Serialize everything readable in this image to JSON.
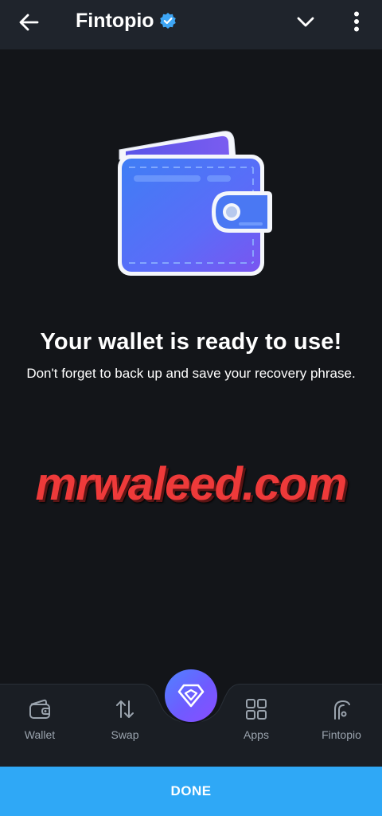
{
  "header": {
    "title": "Fintopio",
    "back_icon": "arrow-left-icon",
    "verified_icon": "verified-badge-icon",
    "collapse_icon": "chevron-down-icon",
    "menu_icon": "more-vertical-icon"
  },
  "main": {
    "illustration_icon": "wallet-icon",
    "heading": "Your wallet is ready to use!",
    "subheading": "Don't forget to back up and save your recovery phrase."
  },
  "watermark": {
    "text": "mrwaleed.com"
  },
  "bottom_nav": {
    "items": [
      {
        "label": "Wallet",
        "icon": "wallet-icon"
      },
      {
        "label": "Swap",
        "icon": "swap-arrows-icon"
      },
      {
        "label": "Apps",
        "icon": "apps-grid-icon"
      },
      {
        "label": "Fintopio",
        "icon": "fintopio-logo-icon"
      }
    ],
    "center_icon": "fintopio-diamond-logo-icon"
  },
  "footer": {
    "done_label": "DONE"
  },
  "colors": {
    "background": "#131519",
    "header": "#1f242c",
    "accent": "#2fa8f6",
    "verified": "#3ea6f5",
    "watermark": "#ee3a3a"
  }
}
